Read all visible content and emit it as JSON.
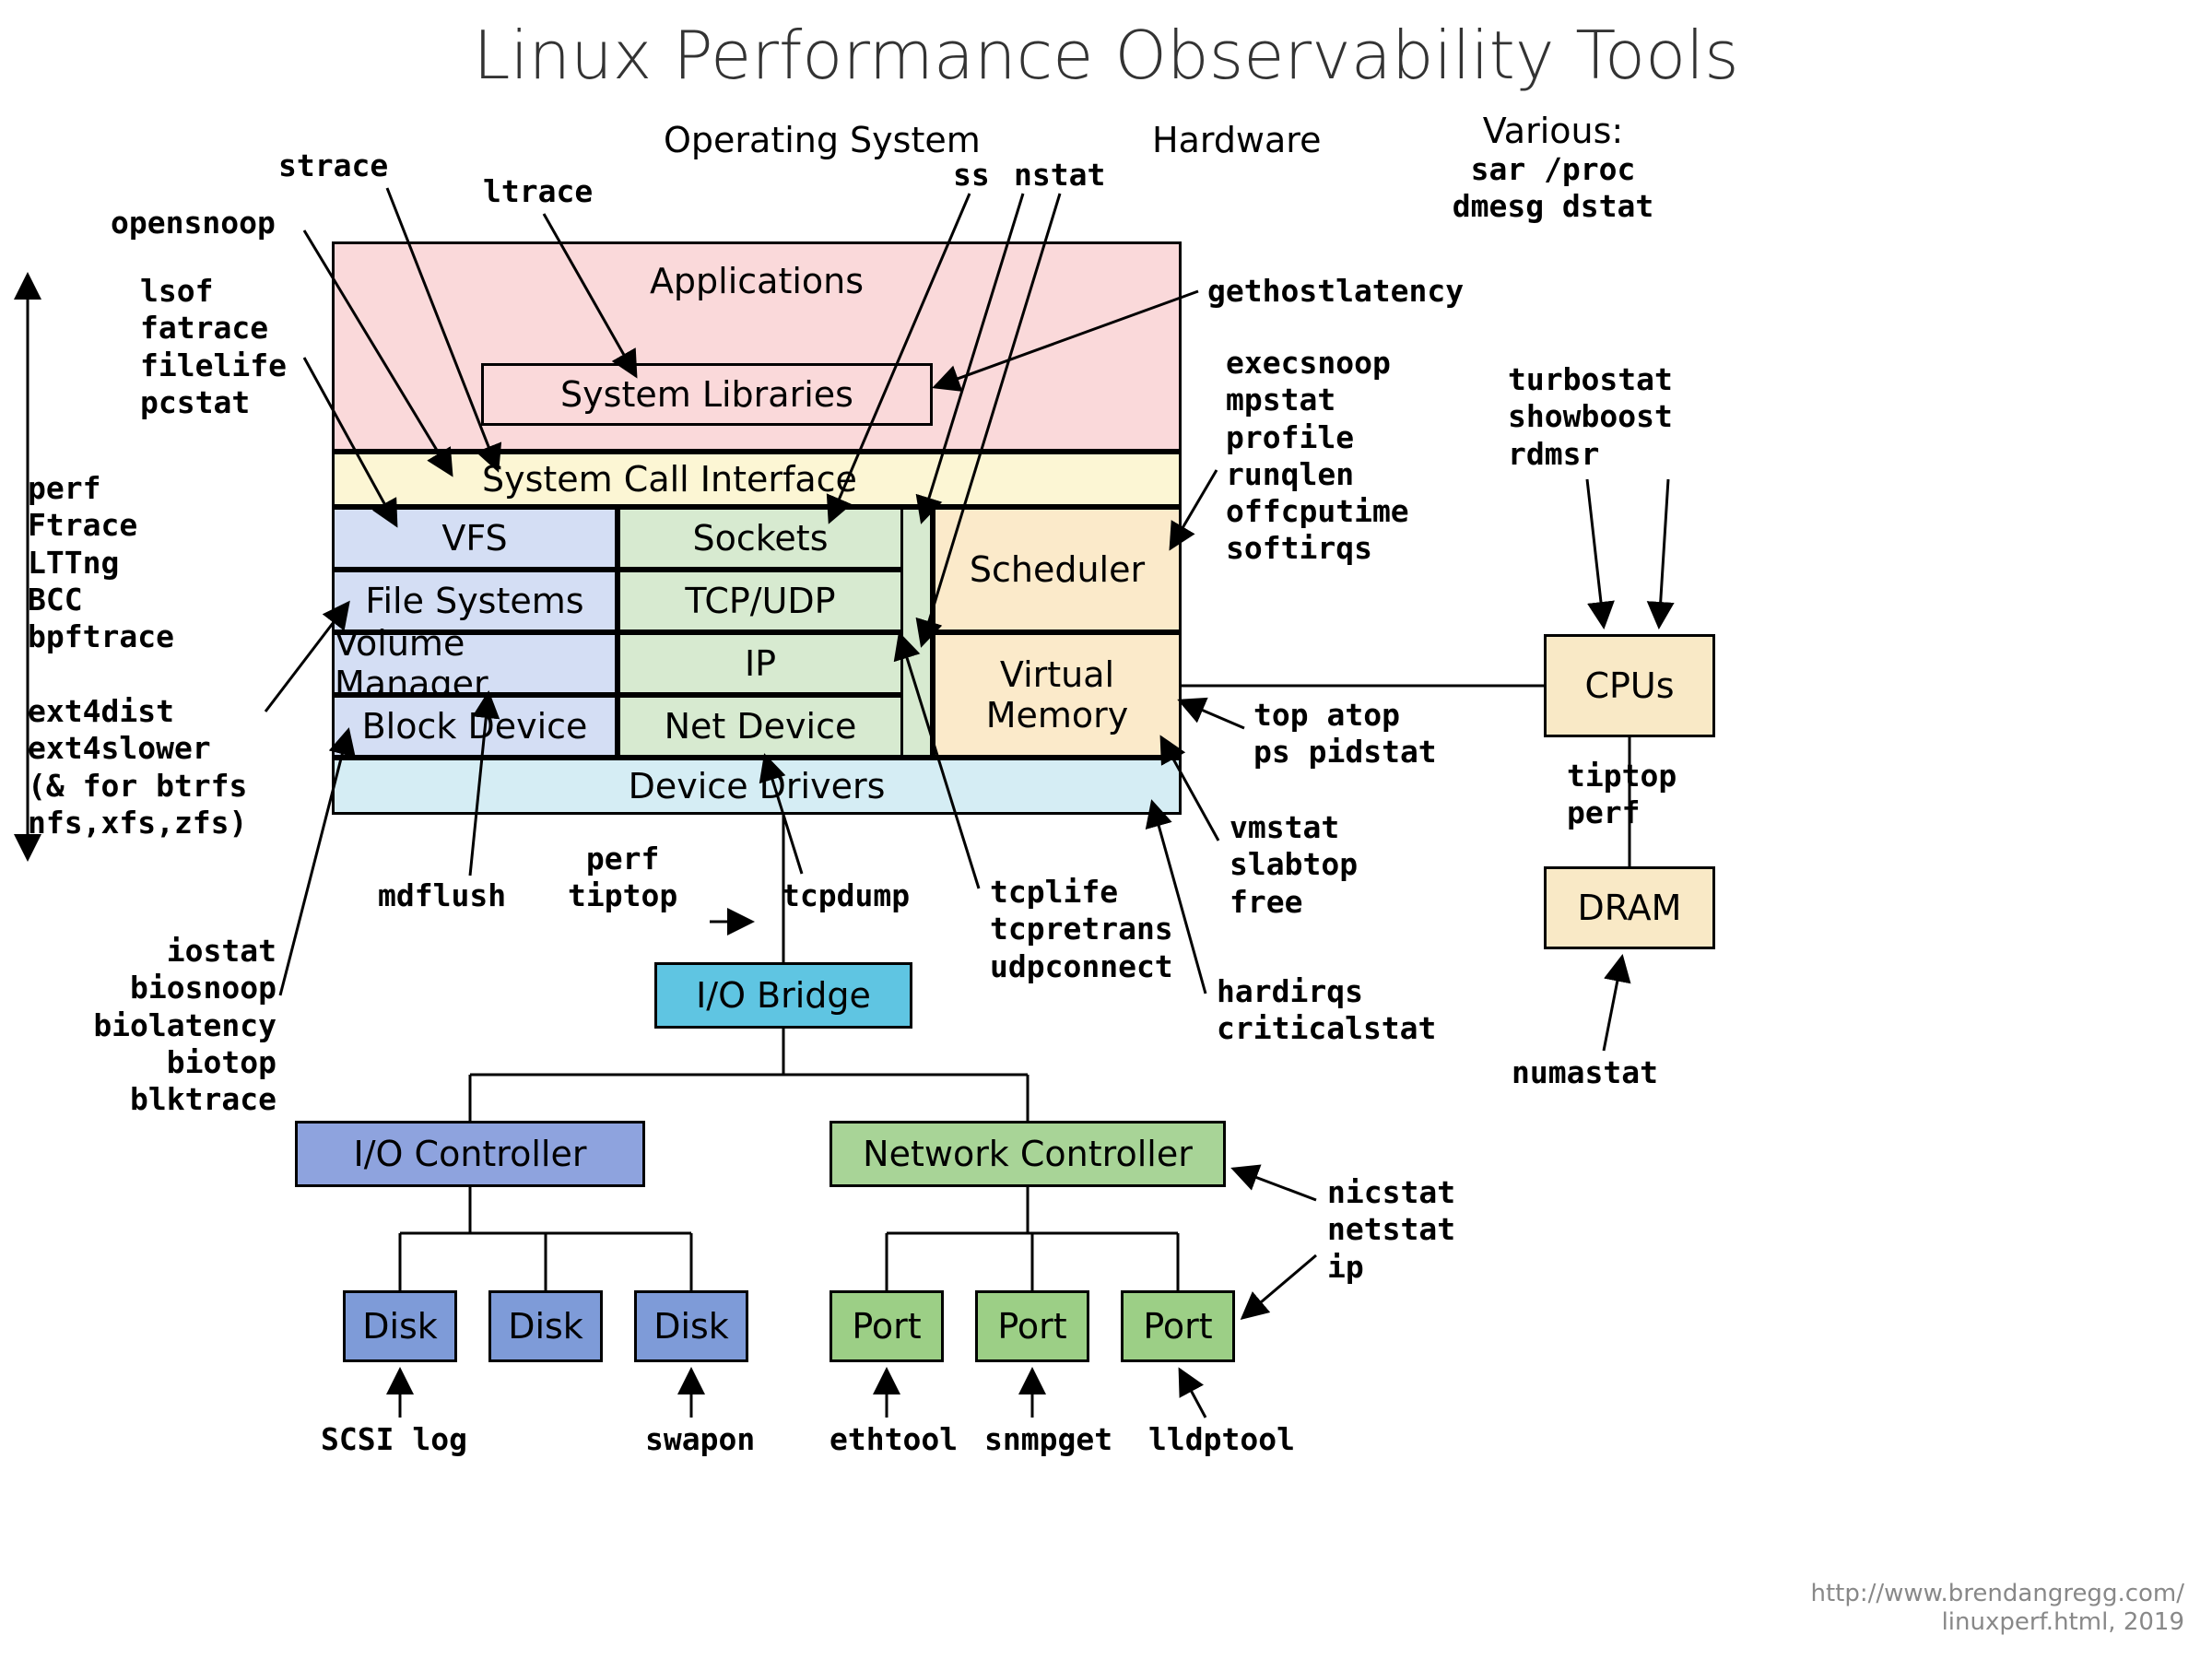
{
  "title": "Linux Performance Observability Tools",
  "section_headers": {
    "os": "Operating System",
    "hw": "Hardware",
    "various": "Various:"
  },
  "various_tools": "sar /proc\ndmesg dstat",
  "stack": {
    "applications": "Applications",
    "system_libraries": "System Libraries",
    "syscall_interface": "System Call Interface",
    "vfs": "VFS",
    "sockets": "Sockets",
    "file_systems": "File Systems",
    "tcp_udp": "TCP/UDP",
    "volume_manager": "Volume Manager",
    "ip": "IP",
    "block_device": "Block Device",
    "net_device": "Net Device",
    "scheduler": "Scheduler",
    "virtual_memory": "Virtual\nMemory",
    "device_drivers": "Device Drivers",
    "io_bridge": "I/O Bridge",
    "io_controller": "I/O Controller",
    "network_controller": "Network Controller",
    "disk": "Disk",
    "port": "Port",
    "cpus": "CPUs",
    "dram": "DRAM"
  },
  "tools": {
    "strace": "strace",
    "ltrace": "ltrace",
    "opensnoop": "opensnoop",
    "lsof_group": "lsof\nfatrace\nfilelife\npcstat",
    "perf_group": "perf\nFtrace\nLTTng\nBCC\nbpftrace",
    "ext4_group": "ext4dist\next4slower\n(& for btrfs\nnfs,xfs,zfs)",
    "iostat_group": "iostat\nbiosnoop\nbiolatency\nbiotop\nblktrace",
    "mdflush": "mdflush",
    "perf_tiptop": "perf\ntiptop",
    "tcpdump": "tcpdump",
    "tcplife_group": "tcplife\ntcpretrans\nudpconnect",
    "ss": "ss",
    "nstat": "nstat",
    "gethostlatency": "gethostlatency",
    "scheduler_group": "execsnoop\nmpstat\nprofile\nrunqlen\noffcputime\nsoftirqs",
    "top_group": "top atop\nps pidstat",
    "vmstat_group": "vmstat\nslabtop\nfree",
    "hardirqs_group": "hardirqs\ncriticalstat",
    "turbo_group": "turbostat\nshowboost\nrdmsr",
    "tiptop_perf": "tiptop\nperf",
    "numastat": "numastat",
    "nic_group": "nicstat\nnetstat\nip",
    "scsi_log": "SCSI log",
    "swapon": "swapon",
    "ethtool": "ethtool",
    "snmpget": "snmpget",
    "lldptool": "lldptool"
  },
  "credit": "http://www.brendangregg.com/\nlinuxperf.html, 2019",
  "colors": {
    "pink": "#FAD9DA",
    "cream": "#FCF6D4",
    "lblue": "#D4DEF4",
    "lgreen": "#D7EAD0",
    "peach": "#FBEACA",
    "cyan": "#D5EDF4",
    "bridge": "#5FC5E2",
    "ioctrl": "#8EA3DE",
    "netctrl": "#A8D497",
    "disk": "#7E9BD8",
    "port": "#9CCF86",
    "hwbox": "#F9E9C6"
  }
}
